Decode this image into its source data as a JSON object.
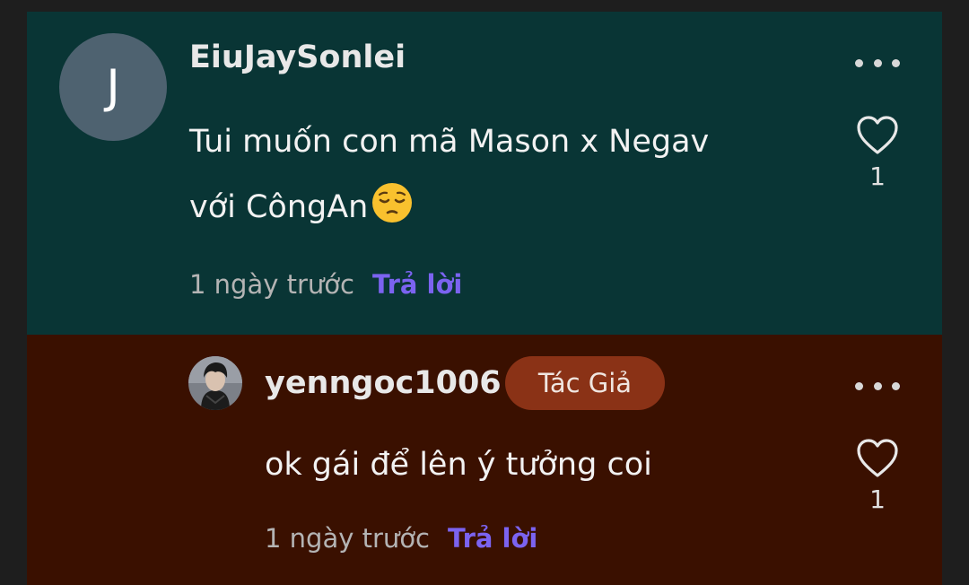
{
  "comments": [
    {
      "avatar_letter": "J",
      "username": "EiuJaySonlei",
      "text_line1": "Tui muốn con mã Mason x Negav",
      "text_line2": "với CôngAn",
      "emoji": "pensive-face-emoji",
      "time": "1 ngày trước",
      "reply_label": "Trả lời",
      "likes": "1"
    },
    {
      "username": "yenngoc1006",
      "badge": "Tác Giả",
      "text": "ok gái để lên ý tưởng coi",
      "time": "1 ngày trước",
      "reply_label": "Trả lời",
      "likes": "1"
    }
  ],
  "icons": {
    "more": "more-horizontal-icon",
    "like": "heart-icon"
  },
  "colors": {
    "page_background": "#1e1e1e",
    "top_comment_background": "#093535",
    "author_reply_background": "#3a1000",
    "reply_link": "#7b63f0",
    "author_badge": "#8a3216"
  }
}
